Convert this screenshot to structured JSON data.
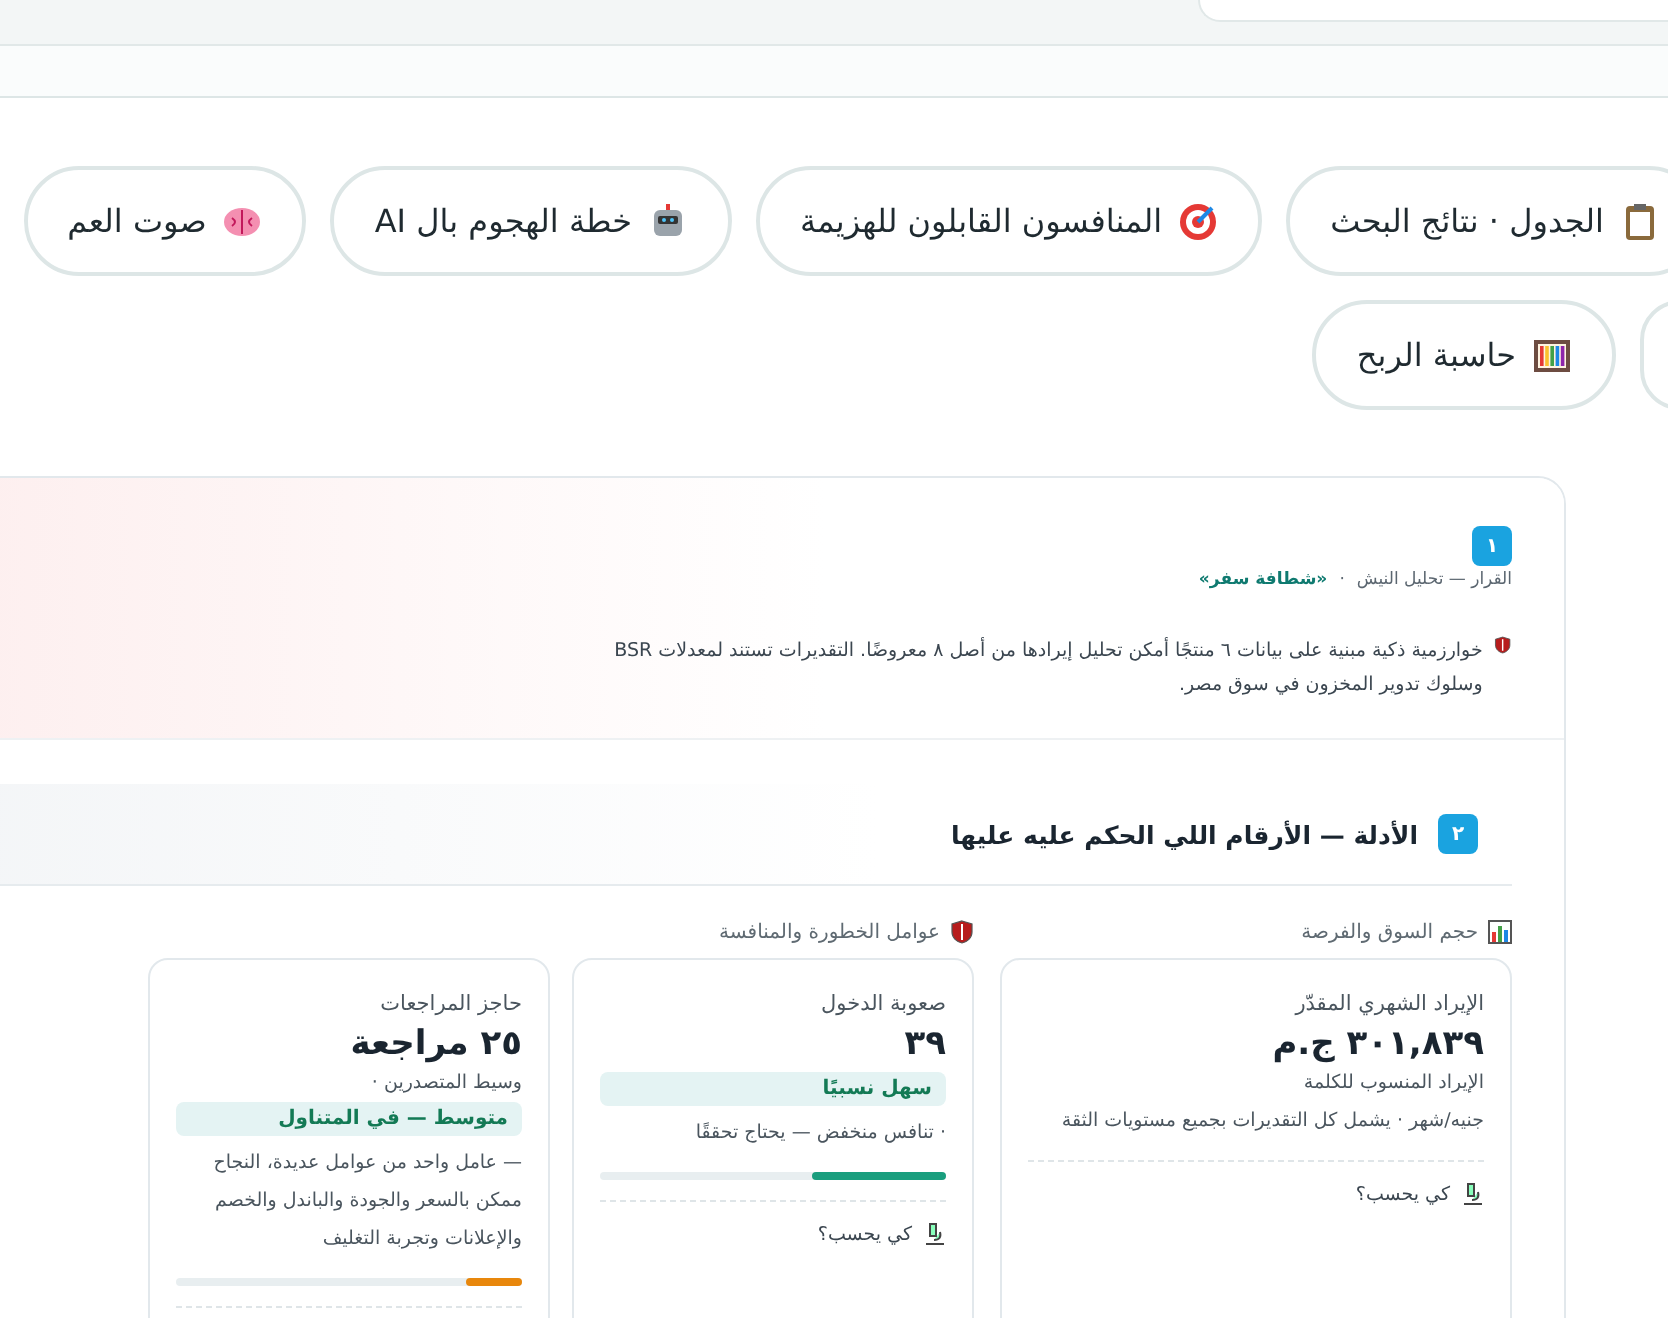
{
  "chip_rows": [
    [
      {
        "kind": "clipboard",
        "label": "الجدول · نتائج البحث"
      },
      {
        "kind": "target",
        "label": "المنافسون القابلون للهزيمة"
      },
      {
        "kind": "robot",
        "label": "خطة الهجوم بال AI"
      },
      {
        "kind": "brain",
        "label": "صوت العم"
      }
    ],
    [
      {
        "kind": "abacus",
        "label": "حاسبة الربح"
      }
    ]
  ],
  "decision": {
    "badge": "١",
    "breadcrumb": {
      "path": "القرار — تحليل النيش",
      "separator": "·",
      "current": "«شطافة سفر»"
    },
    "note": "خوارزمية ذكية مبنية على بيانات ٦ منتجًا أمكن تحليل إيرادها من أصل ٨ معروضًا. التقديرات تستند لمعدلات BSR وسلوك تدوير المخزون في سوق مصر."
  },
  "evidence": {
    "badge": "٢",
    "title": "الأدلة — الأرقام اللي الحكم عليه عليها",
    "groups": [
      {
        "kind": "chart",
        "title": "حجم السوق والفرصة",
        "cards": [
          {
            "title": "الإيراد الشهري المقدّر",
            "value": "٣٠١,٨٣٩ ج.م",
            "subtitle": "الإيراد المنسوب للكلمة",
            "note": "جنيه/شهر · يشمل كل التقديرات بجميع مستويات الثقة",
            "link": "كي يحسب؟"
          }
        ]
      },
      {
        "kind": "shield",
        "title": "عوامل الخطورة والمنافسة",
        "cards": [
          {
            "title": "صعوبة الدخول",
            "value": "٣٩",
            "tag": "سهل نسبيًا",
            "note": "· تنافس منخفض — يحتاج تحققًا",
            "level": 0.39,
            "color": "#1a9e7e",
            "link": "كي يحسب؟"
          },
          {
            "title": "حاجز المراجعات",
            "value": "٢٥ مراجعة",
            "subtitle": "وسيط المتصدرين ·",
            "tag": "متوسط — في المتناول",
            "note": "— عامل واحد من عوامل عديدة، النجاح ممكن بالسعر والجودة والباندل والخصم والإعلانات وتجربة التغليف",
            "level": 0.16,
            "color": "#e8870c"
          }
        ]
      }
    ]
  }
}
